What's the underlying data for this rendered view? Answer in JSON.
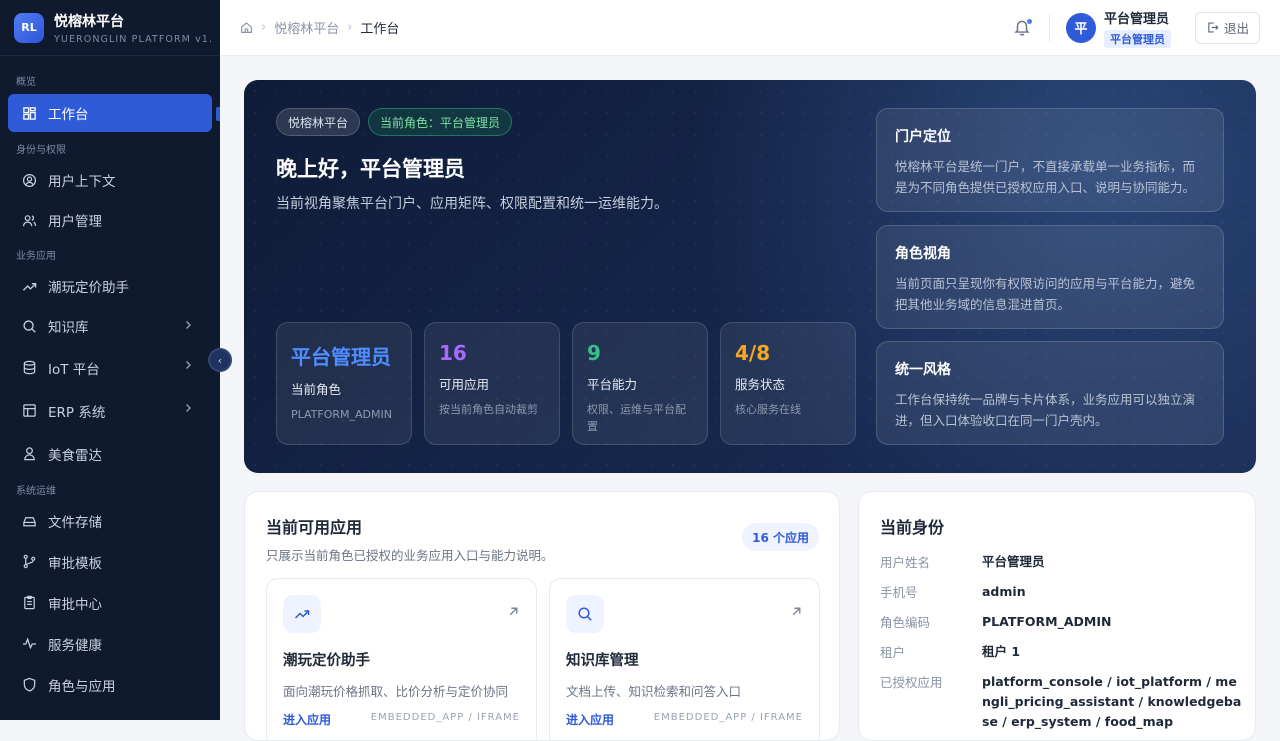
{
  "brand": {
    "logo": "RL",
    "name": "悦榕林平台",
    "sub": "YUERONGLIN PLATFORM v1."
  },
  "sidebar": {
    "sections": [
      "概览",
      "身份与权限",
      "业务应用",
      "系统运维"
    ],
    "items": [
      {
        "label": "工作台",
        "icon": "dashboard-icon"
      },
      {
        "label": "用户上下文",
        "icon": "user-circle-icon"
      },
      {
        "label": "用户管理",
        "icon": "users-icon"
      },
      {
        "label": "潮玩定价助手",
        "icon": "trend-icon"
      },
      {
        "label": "知识库",
        "icon": "search-icon"
      },
      {
        "label": "IoT 平台",
        "icon": "database-icon"
      },
      {
        "label": "ERP 系统",
        "icon": "layout-icon"
      },
      {
        "label": "美食雷达",
        "icon": "chef-icon"
      },
      {
        "label": "文件存储",
        "icon": "drive-icon"
      },
      {
        "label": "审批模板",
        "icon": "branch-icon"
      },
      {
        "label": "审批中心",
        "icon": "clipboard-icon"
      },
      {
        "label": "服务健康",
        "icon": "pulse-icon"
      },
      {
        "label": "角色与应用",
        "icon": "shield-icon"
      }
    ],
    "collapse_glyph": "‹"
  },
  "topbar": {
    "breadcrumb": [
      "悦榕林平台",
      "工作台"
    ],
    "avatar": "平",
    "user_name": "平台管理员",
    "user_role": "平台管理员",
    "logout": "退出"
  },
  "hero": {
    "tag_platform": "悦榕林平台",
    "tag_role": "当前角色：平台管理员",
    "greeting": "晚上好，平台管理员",
    "desc": "当前视角聚焦平台门户、应用矩阵、权限配置和统一运维能力。",
    "stats": [
      {
        "value": "平台管理员",
        "label": "当前角色",
        "sub": "PLATFORM_ADMIN",
        "color": "#4f8cff"
      },
      {
        "value": "16",
        "label": "可用应用",
        "sub": "按当前角色自动裁剪",
        "color": "#a66bff"
      },
      {
        "value": "9",
        "label": "平台能力",
        "sub": "权限、运维与平台配置",
        "color": "#34c08a"
      },
      {
        "value": "4/8",
        "label": "服务状态",
        "sub": "核心服务在线",
        "color": "#f5a623"
      }
    ],
    "info": [
      {
        "title": "门户定位",
        "desc": "悦榕林平台是统一门户，不直接承载单一业务指标，而是为不同角色提供已授权应用入口、说明与协同能力。"
      },
      {
        "title": "角色视角",
        "desc": "当前页面只呈现你有权限访问的应用与平台能力，避免把其他业务域的信息混进首页。"
      },
      {
        "title": "统一风格",
        "desc": "工作台保持统一品牌与卡片体系，业务应用可以独立演进，但入口体验收口在同一门户壳内。"
      }
    ]
  },
  "apps": {
    "title": "当前可用应用",
    "sub": "只展示当前角色已授权的业务应用入口与能力说明。",
    "badge": "16 个应用",
    "items": [
      {
        "name": "潮玩定价助手",
        "desc": "面向潮玩价格抓取、比价分析与定价协同",
        "enter": "进入应用",
        "type": "EMBEDDED_APP / IFRAME",
        "icon": "trend-icon"
      },
      {
        "name": "知识库管理",
        "desc": "文档上传、知识检索和问答入口",
        "enter": "进入应用",
        "type": "EMBEDDED_APP / IFRAME",
        "icon": "search-icon"
      }
    ]
  },
  "identity": {
    "title": "当前身份",
    "rows": [
      {
        "k": "用户姓名",
        "v": "平台管理员"
      },
      {
        "k": "手机号",
        "v": "admin"
      },
      {
        "k": "角色编码",
        "v": "PLATFORM_ADMIN"
      },
      {
        "k": "租户",
        "v": "租户 1"
      },
      {
        "k": "已授权应用",
        "v": "platform_console / iot_platform / mengli_pricing_assistant / knowledgebase / erp_system / food_map"
      }
    ]
  },
  "colors": {
    "accent": "#2f5bd8",
    "sidebar_bg": "#0f1a2e",
    "hero_bg": "#15264a"
  }
}
